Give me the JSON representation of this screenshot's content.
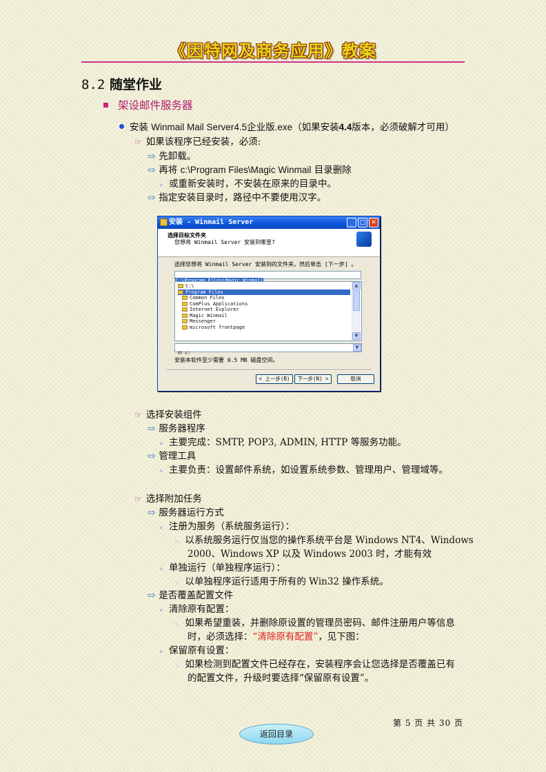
{
  "header": {
    "title": "《因特网及商务应用》教案"
  },
  "section": {
    "number": "8.2",
    "title": "随堂作业"
  },
  "heading2": "架设邮件服务器",
  "install_line": {
    "prefix": "安装 ",
    "product": "Winmail Mail Server4.5",
    "mid": "企业版",
    "ext": ".exe",
    "note_a": "（如果安装",
    "version": "4.4",
    "note_b": "版本，必须破解才可用）"
  },
  "installed": {
    "lead": "如果该程序已经安装，必须:",
    "s1": "先卸载。",
    "s2_a": "再将 ",
    "s2_path": "c:\\Program Files\\Magic Winmail",
    "s2_b": " 目录删除",
    "s2_sub": "或重新安装时，不安装在原来的目录中。",
    "s3": "指定安装目录时，路径中不要使用汉字。"
  },
  "dialog": {
    "title": "安装 - Winmail Server",
    "head_title": "选择目标文件夹",
    "head_sub": "您想将 Winmail Server 安装到哪里?",
    "prompt": "选择您想将 Winmail Server 安装到的文件夹，然后单击 [下一步] 。",
    "path": "C:\\Program Files\\Magic Winmail",
    "folders": [
      "C:\\",
      "Program Files",
      "Common Files",
      "ComPlus Applications",
      "Internet Explorer",
      "Magic Winmail",
      "Messenger",
      "microsoft frontpage"
    ],
    "drive": "c:",
    "space": "安装本软件至少需要 0.5 MB 磁盘空间。",
    "btn_back": "< 上一步(B)",
    "btn_next": "下一步(N) >",
    "btn_cancel": "取消"
  },
  "components": {
    "lead": "选择安装组件",
    "server": "服务器程序",
    "server_desc": "主要完成：SMTP, POP3, ADMIN, HTTP 等服务功能。",
    "admin": "管理工具",
    "admin_desc": "主要负责：设置邮件系统，如设置系统参数、管理用户、管理域等。"
  },
  "tasks": {
    "lead": "选择附加任务",
    "mode": "服务器运行方式",
    "as_service": "注册为服务（系统服务运行）：",
    "as_service_desc1": "以系统服务运行仅当您的操作系统平台是 Windows NT4、Windows",
    "as_service_desc2": "2000、Windows XP 以及 Windows 2003 时，才能有效",
    "standalone": "单独运行（单独程序运行）：",
    "standalone_desc": "以单独程序运行适用于所有的 Win32 操作系统。",
    "overwrite": "是否覆盖配置文件",
    "clear": "清除原有配置：",
    "clear_desc1": "如果希望重装，并删除原设置的管理员密码、邮件注册用户等信息",
    "clear_desc2a": "时，必须选择：",
    "clear_desc2b": "“清除原有配置”",
    "clear_desc2c": "，见下图：",
    "keep": "保留原有设置：",
    "keep_desc1": "如果检测到配置文件已经存在，安装程序会让您选择是否覆盖已有",
    "keep_desc2": "的配置文件，升级时要选择“保留原有设置”。"
  },
  "footer": {
    "page": "第 5 页 共 30 页",
    "back": "返回目录"
  },
  "colors": {
    "header_text": "#e6d51c",
    "rule": "#d0308a",
    "highlight": "#e02020"
  }
}
